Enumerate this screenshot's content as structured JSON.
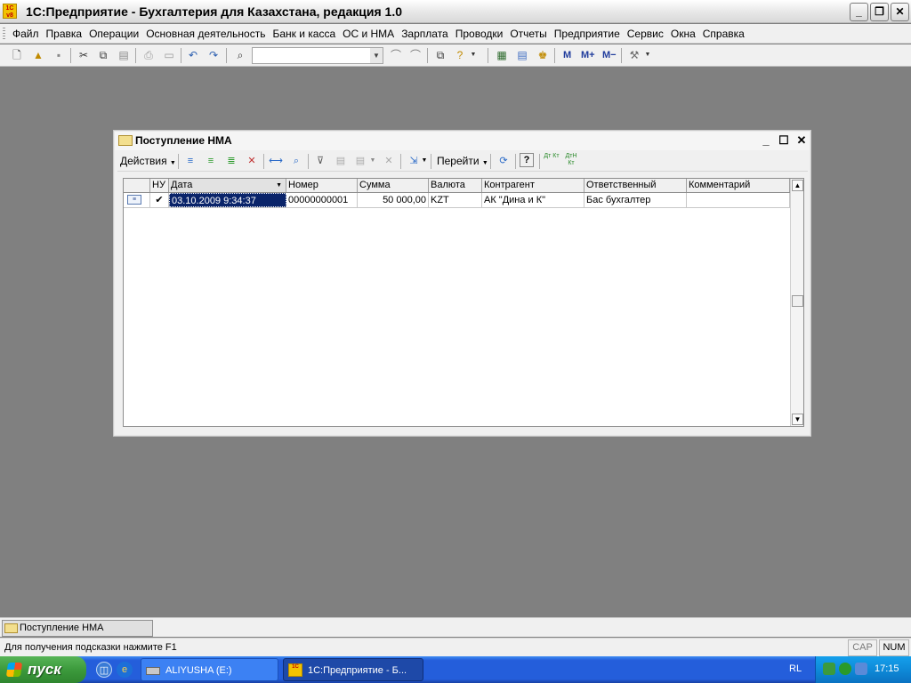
{
  "app": {
    "title": "1С:Предприятие - Бухгалтерия для Казахстана, редакция 1.0",
    "icon_label": "1C v8"
  },
  "menu": {
    "items": [
      "Файл",
      "Правка",
      "Операции",
      "Основная деятельность",
      "Банк и касса",
      "ОС и НМА",
      "Зарплата",
      "Проводки",
      "Отчеты",
      "Предприятие",
      "Сервис",
      "Окна",
      "Справка"
    ]
  },
  "toolbar": {
    "search_value": "",
    "m_buttons": [
      "M",
      "M+",
      "M−"
    ]
  },
  "doc_window": {
    "title": "Поступление НМА",
    "actions_label": "Действия",
    "goto_label": "Перейти",
    "help_label": "?",
    "dt_kt_1": "Дт Кт",
    "dt_kt_2": "ДтН Кт"
  },
  "table": {
    "columns": [
      "",
      "НУ",
      "Дата",
      "Номер",
      "Сумма",
      "Валюта",
      "Контрагент",
      "Ответственный",
      "Комментарий"
    ],
    "rows": [
      {
        "nu": "✔",
        "date": "03.10.2009 9:34:37",
        "number": "00000000001",
        "sum": "50 000,00",
        "currency": "KZT",
        "counterparty": "АК \"Дина и К\"",
        "responsible": "Бас бухгалтер",
        "comment": ""
      }
    ]
  },
  "window_list": {
    "tab_label": "Поступление НМА"
  },
  "status": {
    "hint": "Для получения подсказки нажмите F1",
    "cap": "CAP",
    "num": "NUM"
  },
  "taskbar": {
    "start_label": "пуск",
    "drive_label": "ALIYUSHA (E:)",
    "app_label": "1С:Предприятие - Б...",
    "lang": "RL",
    "time": "17:15"
  },
  "colors": {
    "desktop_bg": "#808080",
    "selection": "#0a246a",
    "taskbar_blue": "#245edb",
    "start_green": "#3c9a3c"
  }
}
